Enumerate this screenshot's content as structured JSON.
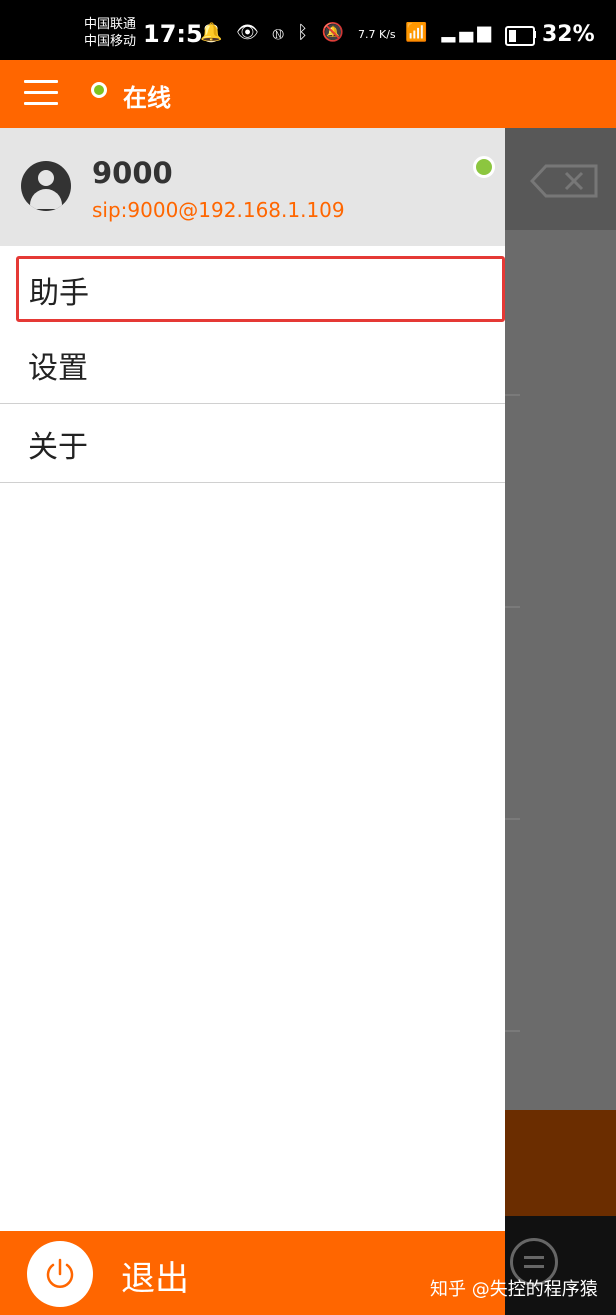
{
  "status_bar": {
    "carrier_1": "中国联通",
    "carrier_2": "中国移动",
    "time": "17:58",
    "net_speed": "7.7 K/s",
    "battery": "32%",
    "battery_level": 0.32
  },
  "app_bar": {
    "status_text": "在线",
    "status_color": "#7fc31f",
    "accent_color": "#ff6600"
  },
  "drawer": {
    "user_name": "9000",
    "user_sip": "sip:9000@192.168.1.109",
    "menu_items": [
      {
        "label": "助手"
      },
      {
        "label": "设置"
      },
      {
        "label": "关于"
      }
    ],
    "selected_index": 0,
    "logout_label": "退出"
  },
  "watermark": "知乎 @失控的程序猿"
}
